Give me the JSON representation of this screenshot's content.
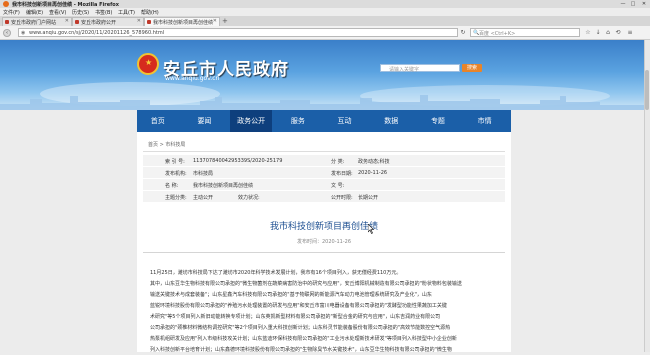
{
  "window": {
    "title": "我市科技创新项目再创佳绩 - Mozilla Firefox",
    "btn_min": "—",
    "btn_max": "□",
    "btn_close": "✕"
  },
  "menu": [
    "文件(F)",
    "编辑(E)",
    "查看(V)",
    "历史(S)",
    "书签(B)",
    "工具(T)",
    "帮助(H)"
  ],
  "tabs": [
    {
      "label": "安丘市政府门户网站"
    },
    {
      "label": "安丘市政府公开"
    },
    {
      "label": "我市科技创新项目再创佳绩"
    }
  ],
  "toolbar": {
    "url": "www.anqiu.gov.cn/sj/2020/11/20201126_578960.html",
    "search_placeholder": "百度 <Ctrl+K>"
  },
  "header": {
    "title": "安丘市人民政府",
    "url": "www.anqiu.gov.cn",
    "search_placeholder": "请输入关键字",
    "search_button": "搜索"
  },
  "nav": [
    "首页",
    "要闻",
    "政务公开",
    "服务",
    "互动",
    "数据",
    "专题",
    "市情"
  ],
  "nav_active": 2,
  "breadcrumb": "首页 > 市科技局",
  "meta": {
    "index_label": "索 引 号:",
    "index_value": "11370784004295339S/2020-25179",
    "category_label": "分 类:",
    "category_value": "政务动态;科技",
    "org_label": "发布机构:",
    "org_value": "市科技局",
    "date_label": "发布日期:",
    "date_value": "2020-11-26",
    "name_label": "名 称:",
    "name_value": "我市科技创新项目再创佳绩",
    "docno_label": "文 号:",
    "docno_value": "",
    "topic_label": "主题分类:",
    "topic_value": "主动公开",
    "scope_label": "效力状况:",
    "scope_value": "",
    "term_label": "公开时限:",
    "term_value": "长期公开"
  },
  "article": {
    "title": "我市科技创新项目再创佳绩",
    "date": "发布时间：2020-11-26",
    "paragraphs": [
      "11月25日，潍坊市科技局下达了潍坊市2020年科学技术发展计划，我市有16个项目列入，获无偿经费110万元。",
      "其中，山东豆华生物科技有限公司承担的\"微生物菌剂在蔬菜病害防治中的研究与应用\"，安丘博阳机械制造有限公司承担的\"粉状物料包装输送",
      "输送关键技术与成套装备\"；山东星鑫汽车科技有限公司承担的\"基于物联网的新能源汽车动力电池管理系统研究及产业化\"，山东",
      "蓝锐环境科技股份有限公司承担的\"养殖污水处理装置的研发与应用\"和安丘市富川电器设备有限公司承担的\"发酵型功能性果蔬加工关键",
      "术研究\"等5个项目列入新旧动能转换专项计划；山东英凯新型材料有限公司承担的\"新型合金的研究与应用\"，山东吉润药业有限公司",
      "公司承担的\"颈椎材料微结构调控研究\"等2个项目列入重大科技创新计划；山东科灵节能装备股份有限公司承担的\"高效节能数控空气源热",
      "热泵机组研发及应用\"列入市级科技攻关计划；山东蓝迪环保科技有限公司承担的\"工业污水处理新技术研发\"等项目列入科技型中小企业创新",
      "列入科技创新平台培育计划；山东鑫德环境科技股份有限公司承担的\"生物除臭节水关键技术\"，山东豆华生物科技有限公司承担的\"微生物"
    ]
  },
  "colors": {
    "nav": "#1b5fa8",
    "nav_active": "#0e3f7d",
    "title": "#1d4f91",
    "emblem": "#d62b1e"
  }
}
